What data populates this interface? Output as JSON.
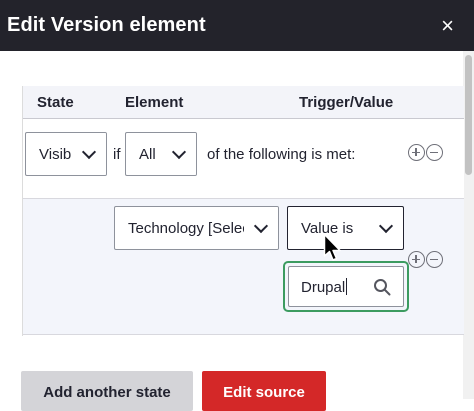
{
  "dialog": {
    "title": "Edit Version element",
    "close_glyph": "×"
  },
  "table": {
    "headers": {
      "state": "State",
      "element": "Element",
      "trigger": "Trigger/Value"
    },
    "row1": {
      "state_value": "Visible",
      "if_label": "if",
      "element_value": "All",
      "condition_text": "of the following is met:"
    },
    "row2": {
      "element_value": "Technology [Select]",
      "trigger_value": "Value is",
      "value_input": "Drupal"
    }
  },
  "buttons": {
    "add_state": "Add another state",
    "edit_source": "Edit source"
  },
  "colors": {
    "titlebar": "#23232b",
    "focus_ring": "#3c9b60",
    "primary_button": "#d42828"
  },
  "icons": [
    "close-icon",
    "chevron-down-icon",
    "plus-circle-icon",
    "minus-circle-icon",
    "search-icon",
    "mouse-pointer-icon"
  ]
}
